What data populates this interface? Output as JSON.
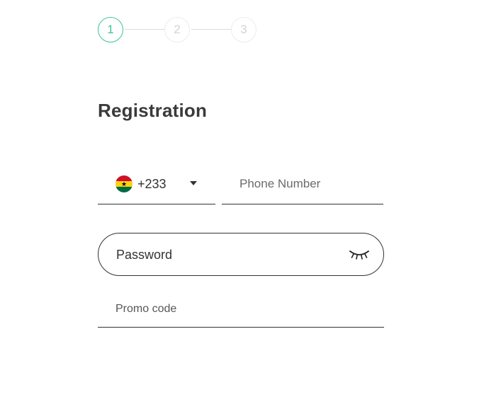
{
  "stepper": {
    "steps": [
      "1",
      "2",
      "3"
    ],
    "active_step": 1,
    "active_color": "#3cc49a"
  },
  "form": {
    "title": "Registration",
    "country": {
      "flag": "ghana-flag-icon",
      "dial_code": "+233"
    },
    "phone": {
      "placeholder": "Phone Number",
      "value": ""
    },
    "password": {
      "placeholder": "Password",
      "value": "",
      "toggle_icon": "eye-closed-icon"
    },
    "promo": {
      "placeholder": "Promo code",
      "value": ""
    }
  }
}
